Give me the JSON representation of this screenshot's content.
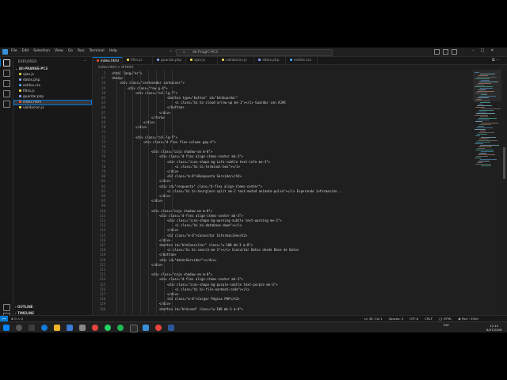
{
  "title_bar": {
    "menu": [
      "File",
      "Edit",
      "Selection",
      "View",
      "Go",
      "Run",
      "Terminal",
      "Help"
    ],
    "command_center": "All-ProgIC-PC3"
  },
  "sidebar": {
    "title": "EXPLORER",
    "project": "All-PRANGE-PC3",
    "files": [
      {
        "name": "ajax.js",
        "color": "#e8d44d"
      },
      {
        "name": "datos.php",
        "color": "#8c9eff"
      },
      {
        "name": "estilos.css",
        "color": "#42a5f5"
      },
      {
        "name": "filtro.js",
        "color": "#e8d44d"
      },
      {
        "name": "guardar.php",
        "color": "#8c9eff"
      },
      {
        "name": "index.html",
        "color": "#e44d26"
      },
      {
        "name": "validacion.js",
        "color": "#e8d44d"
      }
    ],
    "selected_index": 5,
    "outline_label": "OUTLINE",
    "timeline_label": "TIMELINE"
  },
  "tabs": [
    {
      "label": "index.html",
      "active": true,
      "color": "#e44d26"
    },
    {
      "label": "filtro.js",
      "active": false,
      "color": "#e8d44d"
    },
    {
      "label": "guardar.php",
      "active": false,
      "color": "#8c9eff"
    },
    {
      "label": "ajax.js",
      "active": false,
      "color": "#e8d44d"
    },
    {
      "label": "validacion.js",
      "active": false,
      "color": "#e8d44d"
    },
    {
      "label": "datos.php",
      "active": false,
      "color": "#8c9eff"
    },
    {
      "label": "estilos.css",
      "active": false,
      "color": "#42a5f5"
    }
  ],
  "breadcrumb": "index.html > ⊟ html",
  "code_lines": [
    {
      "n": "2",
      "i": 0,
      "t": "<html lang=\"es\">"
    },
    {
      "n": "27",
      "i": 0,
      "t": "<body>"
    },
    {
      "n": "28",
      "i": 1,
      "t": "<div class=\"contenedor container\">"
    },
    {
      "n": "29",
      "i": 2,
      "t": "<div class=\"row g-4\">"
    },
    {
      "n": "30",
      "i": 3,
      "t": "<div class=\"col-lg-7\">"
    },
    {
      "n": "64",
      "i": 7,
      "t": "<button type=\"button\" id=\"btnGuardar\""
    },
    {
      "n": "65",
      "i": 8,
      "t": "<i class=\"bi bi-cloud-arrow-up me-1\"></i> Guardar con AJAX"
    },
    {
      "n": "66",
      "i": 7,
      "t": "</button>"
    },
    {
      "n": "67",
      "i": 6,
      "t": "</div>"
    },
    {
      "n": "68",
      "i": 5,
      "t": "</form>"
    },
    {
      "n": "69",
      "i": 4,
      "t": "</div>"
    },
    {
      "n": "70",
      "i": 3,
      "t": "</div>"
    },
    {
      "n": "71",
      "i": 0,
      "t": ""
    },
    {
      "n": "72",
      "i": 3,
      "t": "<div class=\"col-lg-5\">"
    },
    {
      "n": "73",
      "i": 4,
      "t": "<div class=\"d-flex flex-column gap-4\">"
    },
    {
      "n": "74",
      "i": 0,
      "t": ""
    },
    {
      "n": "75",
      "i": 5,
      "t": "<div class=\"caja shadow-sm m-0\">"
    },
    {
      "n": "76",
      "i": 6,
      "t": "<div class=\"d-flex align-items-center mb-3\">"
    },
    {
      "n": "77",
      "i": 7,
      "t": "<div class=\"icon-shape bg-info-subtle text-info me-3\">"
    },
    {
      "n": "78",
      "i": 8,
      "t": "<i class=\"bi bi-terminal-box\"></i>"
    },
    {
      "n": "79",
      "i": 7,
      "t": "</div>"
    },
    {
      "n": "80",
      "i": 7,
      "t": "<h2 class=\"m-0\">Respuesta Servidor</h2>"
    },
    {
      "n": "81",
      "i": 6,
      "t": "</div>"
    },
    {
      "n": "82",
      "i": 6,
      "t": "<div id=\"respuesta\" class=\"d-flex align-items-center\">"
    },
    {
      "n": "83",
      "i": 7,
      "t": "<i class=\"bi bi-hourglass-split me-2 text-muted animate-pulse\"></i> Esperando información..."
    },
    {
      "n": "84",
      "i": 6,
      "t": "</div>"
    },
    {
      "n": "85",
      "i": 5,
      "t": "</div>"
    },
    {
      "n": "86",
      "i": 0,
      "t": ""
    },
    {
      "n": "110",
      "i": 5,
      "t": "<div class=\"caja shadow-sm m-0\">"
    },
    {
      "n": "111",
      "i": 6,
      "t": "<div class=\"d-flex align-items-center mb-3\">"
    },
    {
      "n": "112",
      "i": 7,
      "t": "<div class=\"icon-shape bg-warning-subtle text-warning me-3\">"
    },
    {
      "n": "113",
      "i": 8,
      "t": "<i class=\"bi bi-database-down\"></i>"
    },
    {
      "n": "114",
      "i": 7,
      "t": "</div>"
    },
    {
      "n": "115",
      "i": 7,
      "t": "<h2 class=\"m-0\">Consultar Información</h2>"
    },
    {
      "n": "116",
      "i": 6,
      "t": "</div>"
    },
    {
      "n": "117",
      "i": 6,
      "t": "<button id=\"btnConsultar\" class=\"w-100 mb-3 m-0\">"
    },
    {
      "n": "118",
      "i": 7,
      "t": "<i class=\"bi bi-search me-1\"></i> Consultar Datos desde Base de Datos"
    },
    {
      "n": "119",
      "i": 6,
      "t": "</button>"
    },
    {
      "n": "120",
      "i": 6,
      "t": "<div id=\"datosServidor\"></div>"
    },
    {
      "n": "121",
      "i": 5,
      "t": "</div>"
    },
    {
      "n": "122",
      "i": 0,
      "t": ""
    },
    {
      "n": "123",
      "i": 5,
      "t": "<div class=\"caja shadow-sm m-0\">"
    },
    {
      "n": "124",
      "i": 6,
      "t": "<div class=\"d-flex align-items-center mb-3\">"
    },
    {
      "n": "125",
      "i": 7,
      "t": "<div class=\"icon-shape bg-purple-subtle text-purple me-3\">"
    },
    {
      "n": "126",
      "i": 8,
      "t": "<i class=\"bi bi-file-earmark-code\"></i>"
    },
    {
      "n": "127",
      "i": 7,
      "t": "</div>"
    },
    {
      "n": "128",
      "i": 7,
      "t": "<h2 class=\"m-0\">Cargar Página PHP</h2>"
    },
    {
      "n": "129",
      "i": 6,
      "t": "</div>"
    },
    {
      "n": "130",
      "i": 6,
      "t": "<button id=\"btnLoad\" class=\"w-100 mb-3 m-0\">"
    }
  ],
  "status_bar": {
    "left": "⊗ 0 ⚠ 0",
    "right": [
      "Ln 36, Col 1",
      "Spaces: 4",
      "UTF-8",
      "CRLF",
      "{} HTML",
      "◉ Port : 5500"
    ]
  },
  "taskbar": {
    "tray": "ESP",
    "time": "12:10",
    "date": "8/07/2026"
  }
}
